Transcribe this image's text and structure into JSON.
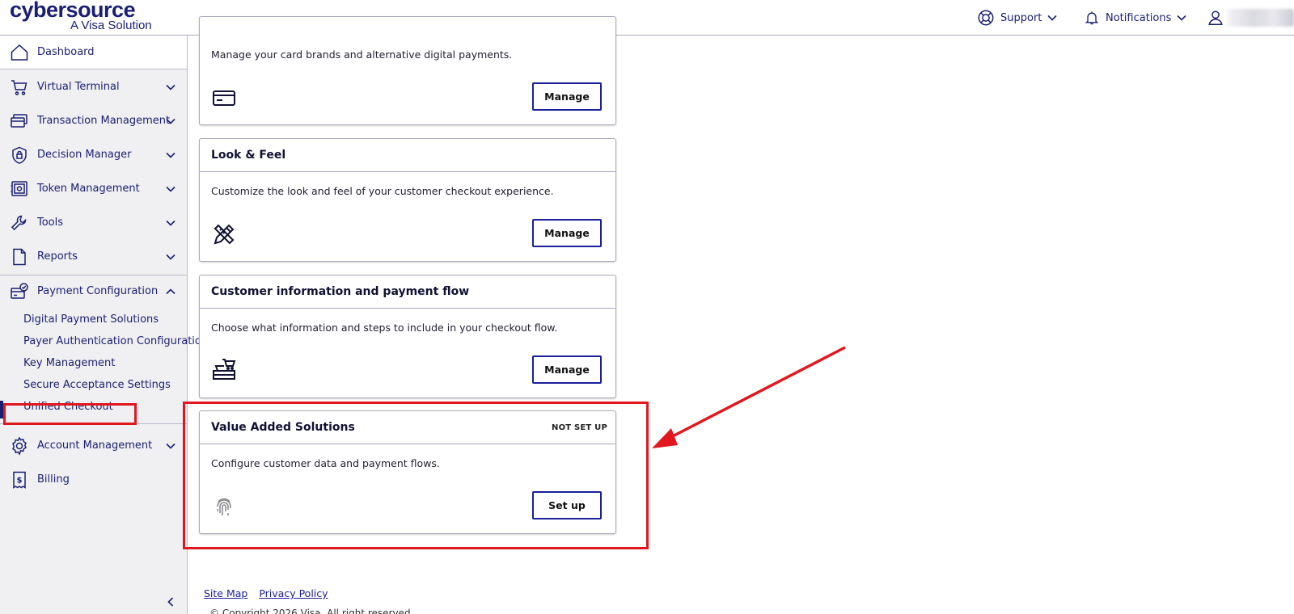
{
  "brand": {
    "name": "cybersource",
    "tagline": "A Visa Solution"
  },
  "header": {
    "support_label": "Support",
    "notifications_label": "Notifications"
  },
  "sidebar": {
    "dashboard": "Dashboard",
    "items": [
      {
        "label": "Virtual Terminal",
        "icon": "cart-icon"
      },
      {
        "label": "Transaction Management",
        "icon": "cards-icon"
      },
      {
        "label": "Decision Manager",
        "icon": "shield-lock-icon"
      },
      {
        "label": "Token Management",
        "icon": "vault-icon"
      },
      {
        "label": "Tools",
        "icon": "wrench-icon"
      },
      {
        "label": "Reports",
        "icon": "document-icon"
      }
    ],
    "payment_configuration": {
      "label": "Payment Configuration",
      "expanded": true,
      "sub_items": [
        "Digital Payment Solutions",
        "Payer Authentication Configuration",
        "Key Management",
        "Secure Acceptance Settings",
        "Unified Checkout"
      ],
      "active_sub_item": "Unified Checkout"
    },
    "account_management": "Account Management",
    "billing": "Billing"
  },
  "cards": [
    {
      "title": "",
      "description": "Manage your card brands and alternative digital payments.",
      "icon": "credit-card-icon",
      "button": "Manage"
    },
    {
      "title": "Look & Feel",
      "description": "Customize the look and feel of your customer checkout experience.",
      "icon": "design-tools-icon",
      "button": "Manage"
    },
    {
      "title": "Customer information and payment flow",
      "description": "Choose what information and steps to include in your checkout flow.",
      "icon": "checkout-counter-icon",
      "button": "Manage"
    },
    {
      "title": "Value Added Solutions",
      "status": "NOT SET UP",
      "description": "Configure customer data and payment flows.",
      "icon": "fingerprint-icon",
      "button": "Set up"
    }
  ],
  "footer": {
    "site_map": "Site Map",
    "privacy_policy": "Privacy Policy",
    "copyright": "© Copyright 2026 Visa. All right reserved."
  },
  "colors": {
    "brand_navy": "#1a1f71",
    "button_border": "#1a1f9a",
    "annotation_red": "#e0181e",
    "sidebar_bg": "#f0f0f2"
  }
}
